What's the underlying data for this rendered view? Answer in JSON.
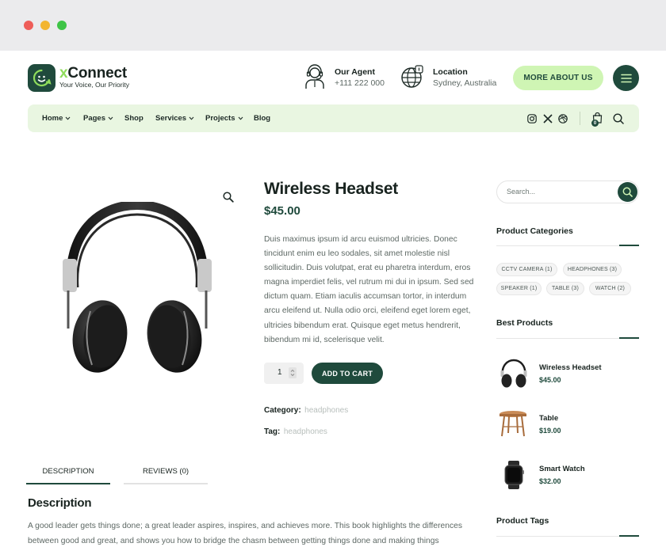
{
  "brand": {
    "name_prefix": "x",
    "name_rest": "Connect",
    "tagline": "Your Voice, Our Priority",
    "primary_color": "#1f4a3c",
    "accent_color": "#cff5b4"
  },
  "header": {
    "agent": {
      "title": "Our Agent",
      "value": "+111 222 000",
      "icon": "agent-headset-icon"
    },
    "location": {
      "title": "Location",
      "value": "Sydney, Australia",
      "icon": "globe-icon"
    },
    "more_button": "MORE ABOUT US",
    "menu_icon": "hamburger-icon"
  },
  "nav": {
    "items": [
      {
        "label": "Home",
        "dropdown": true
      },
      {
        "label": "Pages",
        "dropdown": true
      },
      {
        "label": "Shop",
        "dropdown": false
      },
      {
        "label": "Services",
        "dropdown": true
      },
      {
        "label": "Projects",
        "dropdown": true
      },
      {
        "label": "Blog",
        "dropdown": false
      }
    ],
    "social": [
      "instagram-icon",
      "x-icon",
      "dribbble-icon"
    ],
    "cart_count": "0"
  },
  "product": {
    "title": "Wireless Headset",
    "price": "$45.00",
    "description": "Duis maximus ipsum id arcu euismod ultricies. Donec tincidunt enim eu leo sodales, sit amet molestie nisl sollicitudin. Duis volutpat, erat eu pharetra interdum, eros magna imperdiet felis, vel rutrum mi dui in ipsum. Sed sed dictum quam. Etiam iaculis accumsan tortor, in interdum arcu eleifend ut. Nulla odio orci, eleifend eget lorem eget, ultricies bibendum erat. Quisque eget metus hendrerit, bibendum mi id, scelerisque velit.",
    "quantity": "1",
    "add_to_cart": "ADD TO CART",
    "category_label": "Category:",
    "category_value": "headphones",
    "tag_label": "Tag:",
    "tag_value": "headphones"
  },
  "tabs": [
    {
      "label": "DESCRIPTION",
      "active": true
    },
    {
      "label": "REVIEWS (0)",
      "active": false
    }
  ],
  "description_section": {
    "heading": "Description",
    "text": "A good leader gets things done; a great leader aspires, inspires, and achieves more. This book highlights the differences between good and great, and shows you how to bridge the chasm between getting things done and making things"
  },
  "sidebar": {
    "search_placeholder": "Search...",
    "categories_title": "Product Categories",
    "categories": [
      "CCTV CAMERA (1)",
      "HEADPHONES (3)",
      "SPEAKER (1)",
      "TABLE (3)",
      "WATCH (2)"
    ],
    "best_title": "Best Products",
    "best_products": [
      {
        "name": "Wireless Headset",
        "price": "$45.00"
      },
      {
        "name": "Table",
        "price": "$19.00"
      },
      {
        "name": "Smart Watch",
        "price": "$32.00"
      }
    ],
    "tags_title": "Product Tags"
  }
}
